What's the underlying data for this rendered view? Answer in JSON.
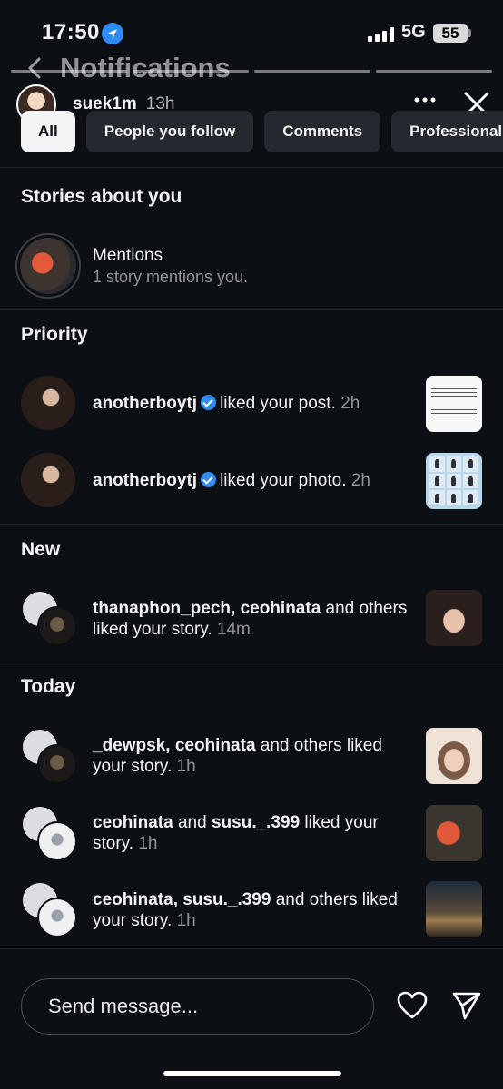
{
  "status": {
    "time": "17:50",
    "network": "5G",
    "battery": "55"
  },
  "header": {
    "title": "Notifications"
  },
  "story": {
    "username": "suek1m",
    "time": "13h"
  },
  "filters": [
    "All",
    "People you follow",
    "Comments",
    "Professional"
  ],
  "sections": {
    "stories": "Stories about you",
    "priority": "Priority",
    "new": "New",
    "today": "Today"
  },
  "mentions": {
    "title": "Mentions",
    "subtitle": "1 story mentions you."
  },
  "priority": [
    {
      "user": "anotherboytj",
      "action": "liked your post.",
      "time": "2h"
    },
    {
      "user": "anotherboytj",
      "action": "liked your photo.",
      "time": "2h"
    }
  ],
  "new": [
    {
      "users": "thanaphon_pech, ceohinata",
      "rest": " and others liked your story.",
      "time": "14m"
    }
  ],
  "today": [
    {
      "users": "_dewpsk, ceohinata",
      "rest": " and others liked your story.",
      "time": "1h"
    },
    {
      "users": "ceohinata",
      "mid": " and ",
      "users2": "susu._.399",
      "rest": " liked your story.",
      "time": "1h"
    },
    {
      "users": "ceohinata, susu._.399",
      "rest": " and others liked your story.",
      "time": "1h"
    }
  ],
  "composer": {
    "placeholder": "Send message..."
  },
  "colors": {
    "background": "#0c0f14",
    "chip": "#25292f",
    "verified": "#2f8cf5"
  }
}
